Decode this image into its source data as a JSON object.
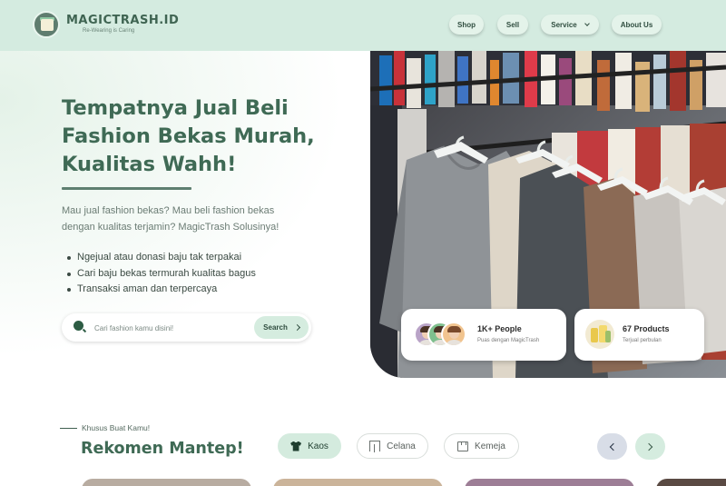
{
  "brand": {
    "name": "MAGICTRASH.ID",
    "tagline": "Re-Wearing is Caring"
  },
  "nav": {
    "shop": "Shop",
    "sell": "Sell",
    "service": "Service",
    "about": "About Us"
  },
  "hero": {
    "title_lines": [
      "Tempatnya Jual Beli",
      "Fashion Bekas Murah,",
      "Kualitas Wahh!"
    ],
    "desc_lines": [
      "Mau jual fashion bekas? Mau beli fashion bekas",
      "dengan kualitas terjamin? MagicTrash Solusinya!"
    ],
    "bullets": [
      "Ngejual atau donasi baju tak terpakai",
      "Cari baju bekas termurah kualitas bagus",
      "Transaksi aman dan terpercaya"
    ],
    "search": {
      "placeholder": "Cari fashion kamu disini!",
      "button": "Search"
    }
  },
  "stats": {
    "people": {
      "title": "1K+ People",
      "subtitle": "Puas dengan MagicTrash"
    },
    "products": {
      "title": "67 Products",
      "subtitle": "Terjual perbulan"
    }
  },
  "recommend": {
    "eyebrow": "Khusus Buat Kamu!",
    "title": "Rekomen Mantep!",
    "chips": [
      "Kaos",
      "Celana",
      "Kemeja"
    ],
    "active_chip": "Kaos"
  },
  "colors": {
    "header_bg": "#d4ebe0",
    "primary_green": "#3f6a55",
    "chip_active": "#d4ebde"
  }
}
